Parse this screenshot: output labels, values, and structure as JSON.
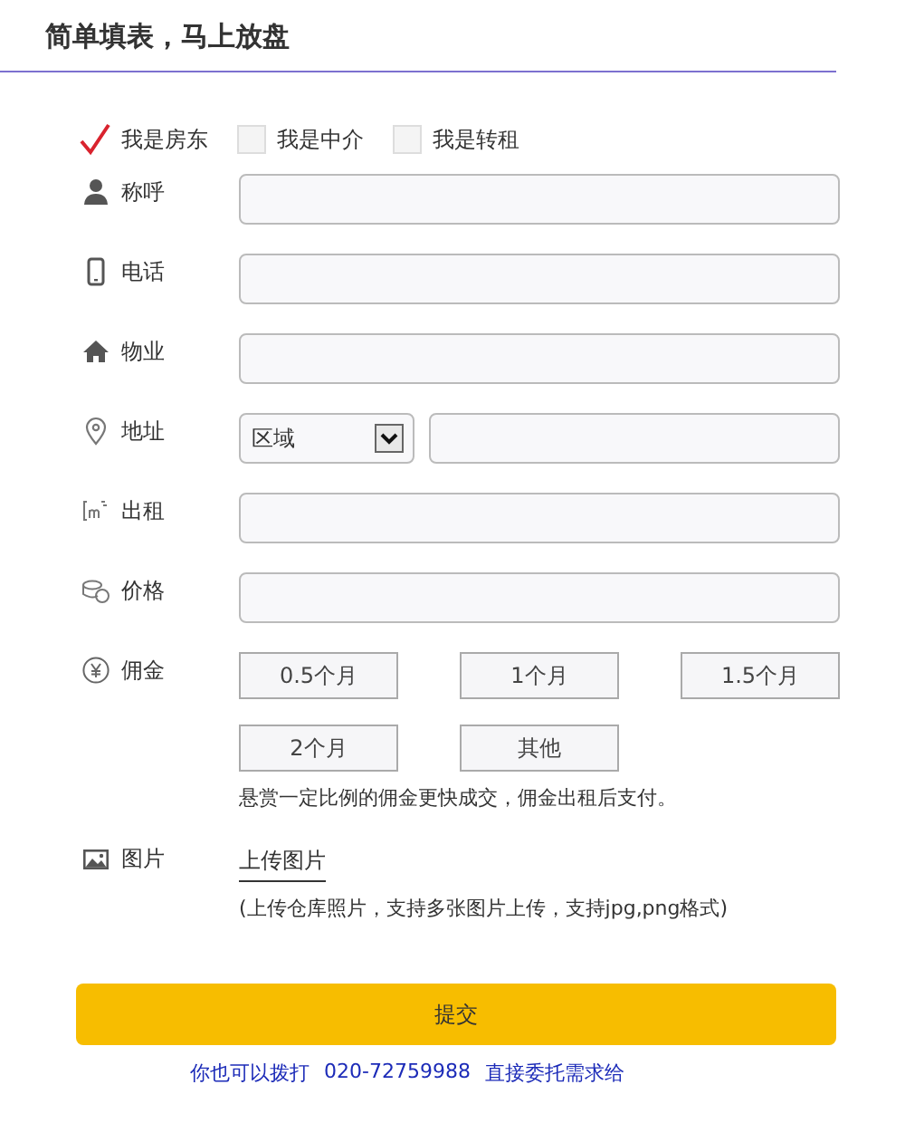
{
  "title": "简单填表，马上放盘",
  "roles": [
    {
      "label": "我是房东",
      "checked": true
    },
    {
      "label": "我是中介",
      "checked": false
    },
    {
      "label": "我是转租",
      "checked": false
    }
  ],
  "fields": [
    {
      "kind": "text",
      "label": "称呼"
    },
    {
      "kind": "text",
      "label": "电话"
    },
    {
      "kind": "text",
      "label": "物业"
    },
    {
      "kind": "address",
      "label": "地址",
      "select": "区域"
    },
    {
      "kind": "text",
      "label": "出租"
    },
    {
      "kind": "text",
      "label": "价格"
    },
    {
      "kind": "commission",
      "label": "佣金",
      "options": [
        "0.5个月",
        "1个月",
        "1.5个月",
        "2个月",
        "其他"
      ],
      "note": "悬赏一定比例的佣金更快成交，佣金出租后支付。"
    },
    {
      "kind": "upload",
      "label": "图片",
      "link": "上传图片",
      "note": "(上传仓库照片，支持多张图片上传，支持jpg,png格式)"
    }
  ],
  "submit": "提交",
  "footer": [
    "你也可以拨打",
    "020-72759988",
    "直接委托需求给"
  ]
}
